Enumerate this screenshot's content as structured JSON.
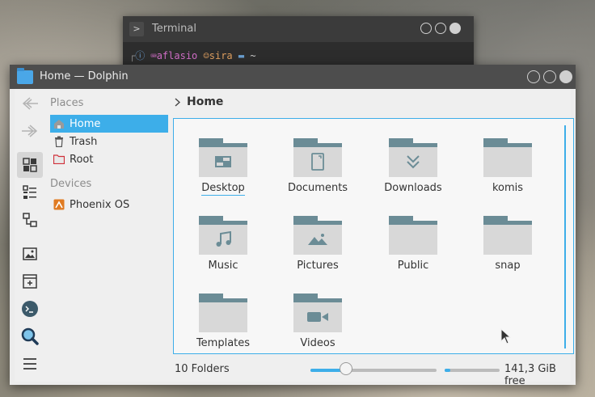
{
  "terminal": {
    "title": "Terminal",
    "prompt": {
      "user": "aflasio",
      "host": "sira",
      "path": "~"
    }
  },
  "dolphin": {
    "title": "Home — Dolphin",
    "breadcrumb": "Home",
    "places": {
      "section_label": "Places",
      "items": [
        {
          "label": "Home",
          "icon": "home-icon",
          "selected": true
        },
        {
          "label": "Trash",
          "icon": "trash-icon"
        },
        {
          "label": "Root",
          "icon": "root-folder-icon"
        }
      ]
    },
    "devices": {
      "section_label": "Devices",
      "items": [
        {
          "label": "Phoenix OS",
          "icon": "drive-icon"
        }
      ]
    },
    "folders": [
      {
        "label": "Desktop",
        "icon": "desktop-icon"
      },
      {
        "label": "Documents",
        "icon": "document-icon"
      },
      {
        "label": "Downloads",
        "icon": "download-icon"
      },
      {
        "label": "komis",
        "icon": "folder-icon"
      },
      {
        "label": "Music",
        "icon": "music-icon"
      },
      {
        "label": "Pictures",
        "icon": "image-icon"
      },
      {
        "label": "Public",
        "icon": "folder-icon"
      },
      {
        "label": "snap",
        "icon": "folder-icon"
      },
      {
        "label": "Templates",
        "icon": "folder-icon"
      },
      {
        "label": "Videos",
        "icon": "video-icon"
      }
    ],
    "status": {
      "count": "10 Folders",
      "zoom_level": 0.28,
      "disk_used_fraction": 0.1,
      "free_space": "141,3 GiB free"
    },
    "colors": {
      "accent": "#3daee9",
      "folder_tab": "#6b8c96",
      "folder_body": "#d8d8d8"
    }
  }
}
